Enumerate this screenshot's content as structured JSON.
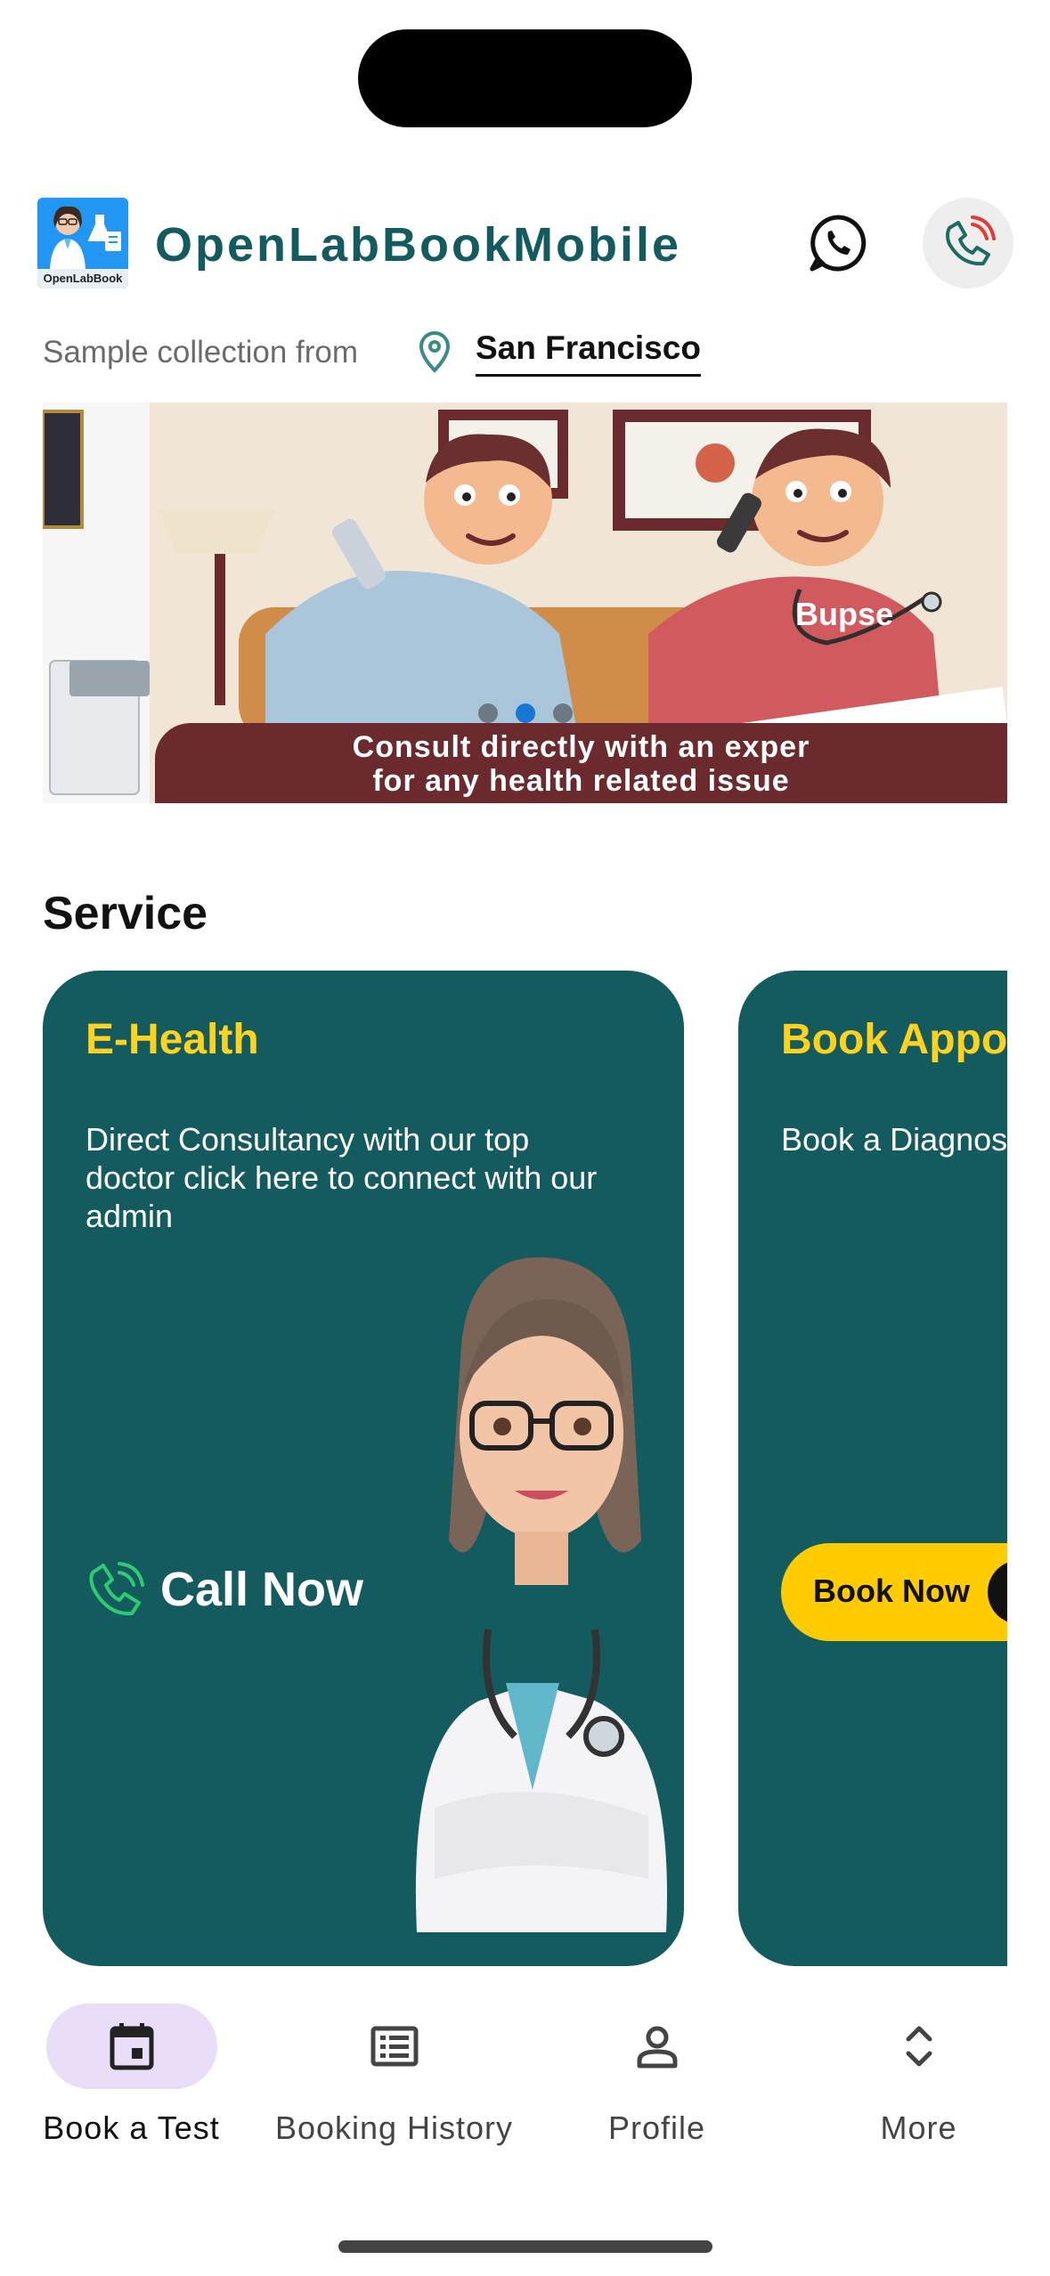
{
  "header": {
    "app_title": "OpenLabBookMobile",
    "logo_text": "OpenLabBook",
    "whatsapp_icon": "whatsapp-icon",
    "call_icon": "phone-ringing-icon"
  },
  "location": {
    "label": "Sample collection from",
    "city": "San Francisco",
    "icon": "location-pin-icon"
  },
  "banner": {
    "caption_line1": "Consult directly with an exper",
    "caption_line2": "for any health related issue",
    "shirt_text": "Bupse",
    "slides_total": 3,
    "active_slide": 2
  },
  "services": {
    "title": "Service",
    "cards": [
      {
        "title": "E-Health",
        "description": "Direct Consultancy with our top doctor click here to connect with our admin",
        "action_label": "Call Now",
        "action_icon": "phone-icon"
      },
      {
        "title": "Book Appoi",
        "description": "Book a Diagnos Blood Test , X- etc.",
        "action_label": "Book Now",
        "action_icon": "arrow-right-icon"
      }
    ]
  },
  "nav": {
    "items": [
      {
        "label": "Book a Test",
        "icon": "calendar-icon",
        "active": true
      },
      {
        "label": "Booking History",
        "icon": "list-icon",
        "active": false
      },
      {
        "label": "Profile",
        "icon": "person-icon",
        "active": false
      },
      {
        "label": "More",
        "icon": "expand-icon",
        "active": false
      }
    ]
  },
  "colors": {
    "brand_teal": "#135b5e",
    "accent_yellow": "#ffd21e",
    "button_yellow": "#ffcc00",
    "nav_active_pill": "#eaddf7",
    "carousel_active_dot": "#1976d2"
  }
}
